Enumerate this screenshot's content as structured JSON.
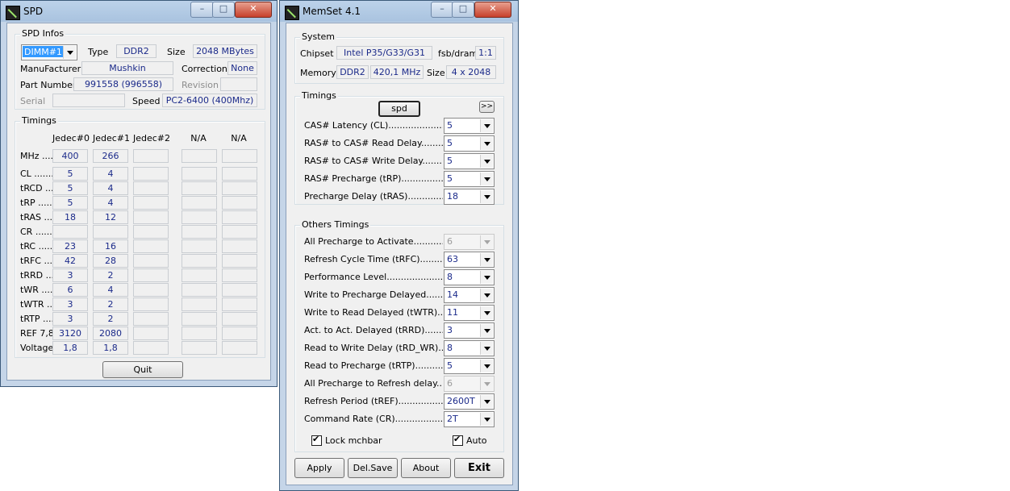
{
  "spd": {
    "title": "SPD",
    "infos": {
      "group_title": "SPD Infos",
      "dimm": "DIMM#1",
      "type_label": "Type",
      "type_value": "DDR2",
      "size_label": "Size",
      "size_value": "2048 MBytes",
      "manufacturer_label": "ManuFacturer",
      "manufacturer_value": "Mushkin",
      "correction_label": "Correction",
      "correction_value": "None",
      "part_label": "Part Number",
      "part_value": "991558 (996558)",
      "revision_label": "Revision",
      "revision_value": "",
      "serial_label": "Serial",
      "serial_value": "",
      "speed_label": "Speed",
      "speed_value": "PC2-6400 (400Mhz)"
    },
    "timings": {
      "group_title": "Timings",
      "columns": [
        "Jedec#0",
        "Jedec#1",
        "Jedec#2",
        "N/A",
        "N/A"
      ],
      "rows": [
        {
          "label": "MHz .....",
          "values": [
            "400",
            "266",
            "",
            "",
            ""
          ]
        },
        {
          "label": "CL .........",
          "values": [
            "5",
            "4",
            "",
            "",
            ""
          ]
        },
        {
          "label": "tRCD ......",
          "values": [
            "5",
            "4",
            "",
            "",
            ""
          ]
        },
        {
          "label": "tRP ........",
          "values": [
            "5",
            "4",
            "",
            "",
            ""
          ]
        },
        {
          "label": "tRAS ......",
          "values": [
            "18",
            "12",
            "",
            "",
            ""
          ]
        },
        {
          "label": "CR .........",
          "values": [
            "",
            "",
            "",
            "",
            ""
          ]
        },
        {
          "label": "tRC ........",
          "values": [
            "23",
            "16",
            "",
            "",
            ""
          ]
        },
        {
          "label": "tRFC ......",
          "values": [
            "42",
            "28",
            "",
            "",
            ""
          ]
        },
        {
          "label": "tRRD ......",
          "values": [
            "3",
            "2",
            "",
            "",
            ""
          ]
        },
        {
          "label": "tWR .......",
          "values": [
            "6",
            "4",
            "",
            "",
            ""
          ]
        },
        {
          "label": "tWTR ......",
          "values": [
            "3",
            "2",
            "",
            "",
            ""
          ]
        },
        {
          "label": "tRTP ......",
          "values": [
            "3",
            "2",
            "",
            "",
            ""
          ]
        },
        {
          "label": "REF 7,8",
          "values": [
            "3120",
            "2080",
            "",
            "",
            ""
          ]
        },
        {
          "label": "Voltage",
          "values": [
            "1,8",
            "1,8",
            "",
            "",
            ""
          ]
        }
      ]
    },
    "quit_label": "Quit"
  },
  "memset": {
    "title": "MemSet 4.1",
    "system": {
      "group_title": "System",
      "chipset_label": "Chipset",
      "chipset_value": "Intel P35/G33/G31",
      "fsb_label": "fsb/dram",
      "fsb_value": "1:1",
      "memory_label": "Memory",
      "memory_type": "DDR2",
      "memory_freq": "420,1 MHz",
      "size_label": "Size",
      "size_value": "4 x 2048"
    },
    "timings": {
      "group_title": "Timings",
      "spd_button": "spd",
      "more_button": ">>",
      "rows": [
        {
          "label": "CAS# Latency (CL).........................",
          "value": "5"
        },
        {
          "label": "RAS# to CAS# Read Delay.............",
          "value": "5"
        },
        {
          "label": "RAS# to CAS# Write Delay............",
          "value": "5"
        },
        {
          "label": "RAS# Precharge (tRP)....................",
          "value": "5"
        },
        {
          "label": "Precharge Delay  (tRAS)..................",
          "value": "18"
        }
      ]
    },
    "others": {
      "group_title": "Others Timings",
      "rows": [
        {
          "label": "All Precharge to Activate....................",
          "value": "6",
          "disabled": true
        },
        {
          "label": "Refresh Cycle Time (tRFC)...................",
          "value": "63",
          "disabled": false
        },
        {
          "label": "Performance Level............................",
          "value": "8",
          "disabled": false
        },
        {
          "label": "Write to Precharge Delayed...............",
          "value": "14",
          "disabled": false
        },
        {
          "label": "Write to Read Delayed (tWTR).........",
          "value": "11",
          "disabled": false
        },
        {
          "label": "Act. to Act. Delayed (tRRD)..............",
          "value": "3",
          "disabled": false
        },
        {
          "label": "Read to Write Delay (tRD_WR).........",
          "value": "8",
          "disabled": false
        },
        {
          "label": "Read to Precharge (tRTP)................",
          "value": "5",
          "disabled": false
        },
        {
          "label": "All Precharge to Refresh delay..........",
          "value": "6",
          "disabled": true
        },
        {
          "label": "Refresh Period (tREF)......................",
          "value": "2600T",
          "disabled": false
        },
        {
          "label": "Command Rate (CR)...........................",
          "value": "2T",
          "disabled": false
        }
      ],
      "lock_label": "Lock mchbar",
      "auto_label": "Auto"
    },
    "buttons": {
      "apply": "Apply",
      "delsave": "Del.Save",
      "about": "About",
      "exit": "Exit"
    }
  }
}
